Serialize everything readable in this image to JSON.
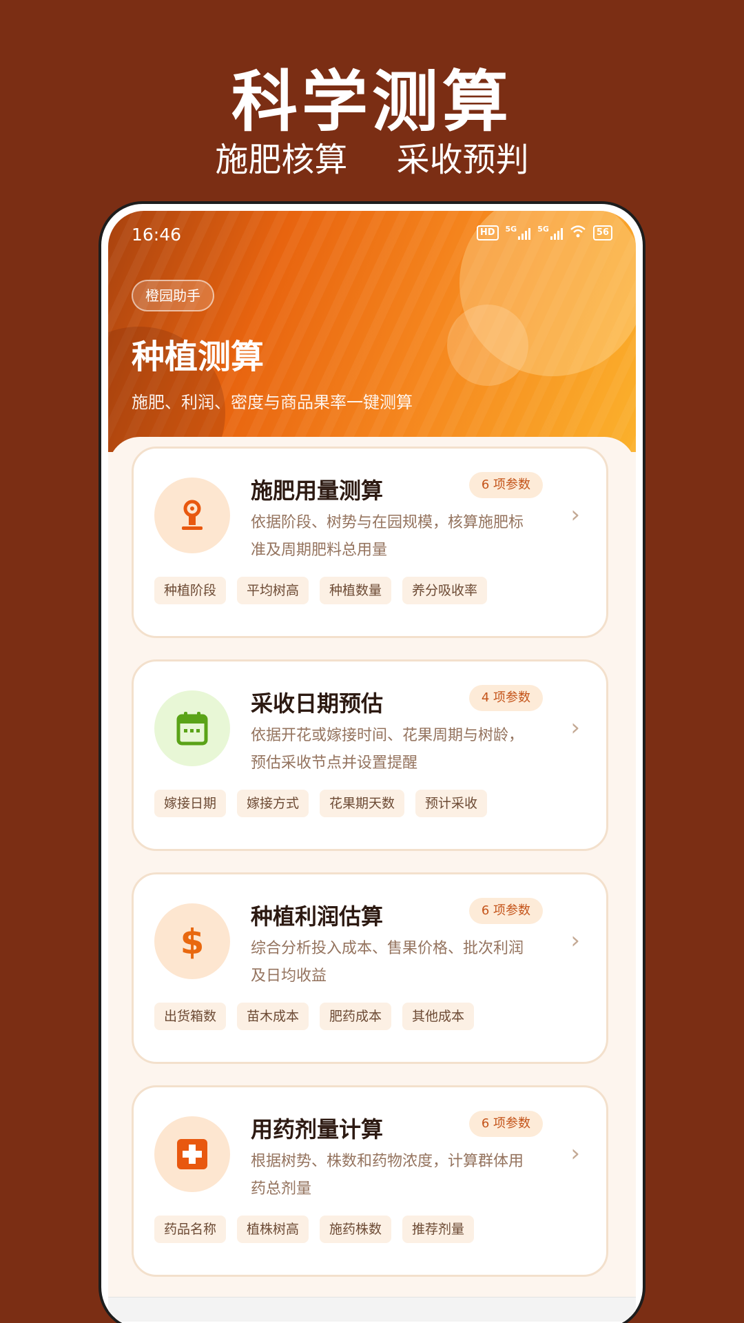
{
  "promo": {
    "title": "科学测算",
    "subtitle_left": "施肥核算",
    "subtitle_right": "采收预判"
  },
  "status_bar": {
    "time": "16:46",
    "hd_label": "HD",
    "sim1_label": "5G",
    "sim2_label": "5G",
    "battery": "56",
    "icons": [
      "hd-icon",
      "signal-icon",
      "signal-icon",
      "wifi-icon",
      "battery-icon"
    ]
  },
  "header": {
    "app_badge": "橙园助手",
    "title": "种植测算",
    "description": "施肥、利润、密度与商品果率一键测算"
  },
  "cards": [
    {
      "title": "施肥用量测算",
      "count": "6 项参数",
      "desc_line1": "依据阶段、树势与在园规模，核算施肥标",
      "desc_line2": "准及周期肥料总用量",
      "icon": "fertilizer-icon",
      "icon_bg": "#fde6d0",
      "icon_color": "#e8580f",
      "tags": [
        "种植阶段",
        "平均树高",
        "种植数量",
        "养分吸收率"
      ]
    },
    {
      "title": "采收日期预估",
      "count": "4 项参数",
      "desc_line1": "依据开花或嫁接时间、花果周期与树龄，",
      "desc_line2": "预估采收节点并设置提醒",
      "icon": "calendar-icon",
      "icon_bg": "#e8f7d6",
      "icon_color": "#5aa318",
      "tags": [
        "嫁接日期",
        "嫁接方式",
        "花果期天数",
        "预计采收"
      ]
    },
    {
      "title": "种植利润估算",
      "count": "6 项参数",
      "desc_line1": "综合分析投入成本、售果价格、批次利润",
      "desc_line2": "及日均收益",
      "icon": "dollar-icon",
      "icon_bg": "#fde6d0",
      "icon_color": "#e8680f",
      "tags": [
        "出货箱数",
        "苗木成本",
        "肥药成本",
        "其他成本"
      ]
    },
    {
      "title": "用药剂量计算",
      "count": "6 项参数",
      "desc_line1": "根据树势、株数和药物浓度，计算群体用",
      "desc_line2": "药总剂量",
      "icon": "medicine-icon",
      "icon_bg": "#fde6d0",
      "icon_color": "#e8580f",
      "tags": [
        "药品名称",
        "植株树高",
        "施药株数",
        "推荐剂量"
      ]
    }
  ],
  "arrow_glyph": "›"
}
